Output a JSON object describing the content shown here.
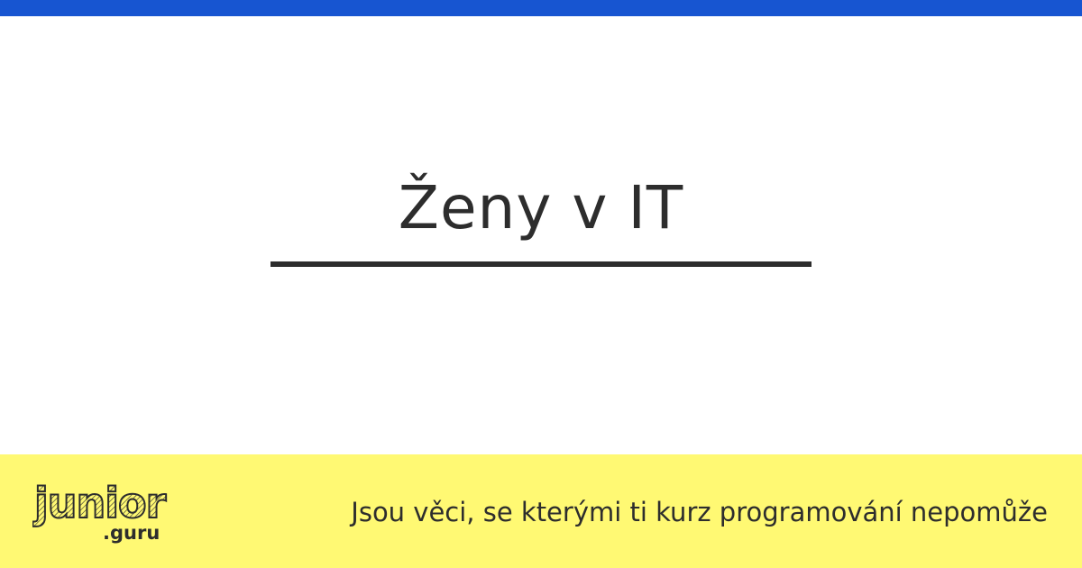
{
  "page": {
    "title": "Ženy v IT",
    "tagline": "Jsou věci, se kterými ti kurz programování nepomůže"
  },
  "logo": {
    "wordmark": "junior",
    "domain": ".guru"
  },
  "colors": {
    "top_bar": "#1755d1",
    "footer_background": "#fff973",
    "text": "#2d2d2d"
  }
}
